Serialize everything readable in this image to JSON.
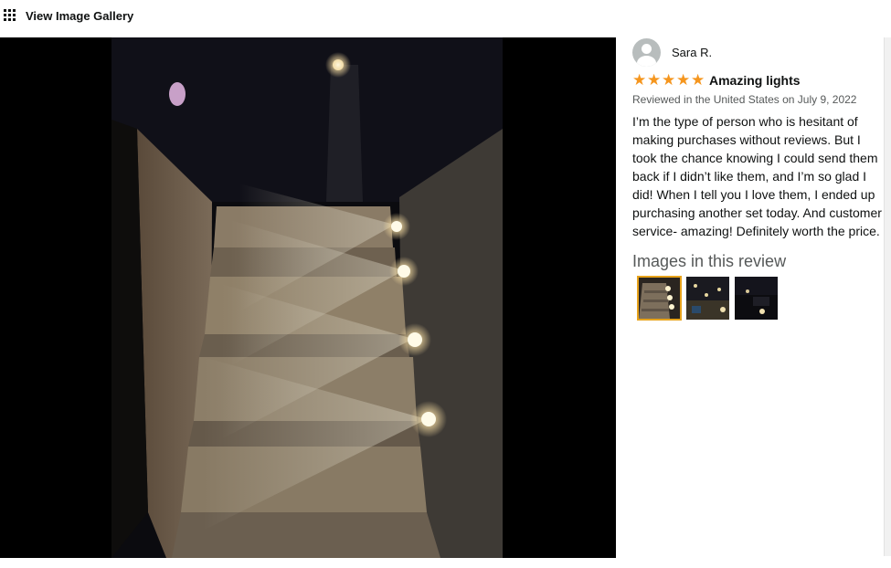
{
  "toolbar": {
    "gallery_label": "View Image Gallery",
    "gallery_icon": "grid-icon"
  },
  "viewer": {
    "photo_icon": "photo-main"
  },
  "review": {
    "reviewer_name": "Sara R.",
    "rating": 5,
    "rating_max": 5,
    "title": "Amazing lights",
    "date": "Reviewed in the United States on July 9, 2022",
    "body": "I’m the type of person who is hesitant of making purchases without reviews. But I took the chance knowing I could send them back if I didn’t like them, and I’m so glad I did! When I tell you I love them, I ended up purchasing another set today. And customer service- amazing! Definitely worth the price.",
    "star_color": "#f5961e"
  },
  "images_section": {
    "heading": "Images in this review",
    "thumbnails": [
      {
        "name": "thumbnail-1",
        "selected": true
      },
      {
        "name": "thumbnail-2",
        "selected": false
      },
      {
        "name": "thumbnail-3",
        "selected": false
      }
    ],
    "selected_border_color": "#e7a31c"
  }
}
